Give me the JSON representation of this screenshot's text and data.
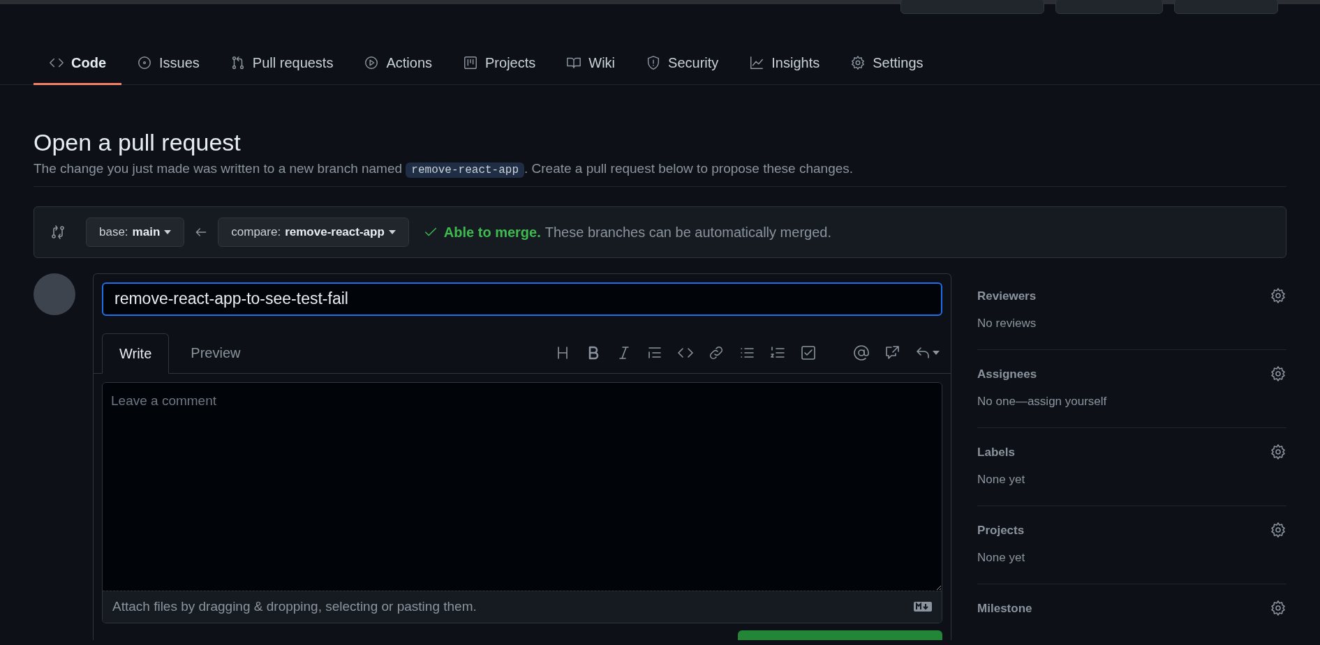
{
  "nav": [
    {
      "label": "Code",
      "selected": true
    },
    {
      "label": "Issues",
      "selected": false
    },
    {
      "label": "Pull requests",
      "selected": false
    },
    {
      "label": "Actions",
      "selected": false
    },
    {
      "label": "Projects",
      "selected": false
    },
    {
      "label": "Wiki",
      "selected": false
    },
    {
      "label": "Security",
      "selected": false
    },
    {
      "label": "Insights",
      "selected": false
    },
    {
      "label": "Settings",
      "selected": false
    }
  ],
  "page": {
    "title": "Open a pull request",
    "intro_before": "The change you just made was written to a new branch named",
    "branch": "remove-react-app",
    "intro_after": ". Create a pull request below to propose these changes."
  },
  "compare": {
    "base_label": "base:",
    "base": "main",
    "compare_label": "compare:",
    "compare": "remove-react-app",
    "merge_status": "Able to merge.",
    "merge_note": "These branches can be automatically merged."
  },
  "form": {
    "title_value": "remove-react-app-to-see-test-fail",
    "tabs": [
      {
        "label": "Write",
        "selected": true
      },
      {
        "label": "Preview",
        "selected": false
      }
    ],
    "comment_placeholder": "Leave a comment",
    "attach_hint": "Attach files by dragging & dropping, selecting or pasting them."
  },
  "sidebar": [
    {
      "title": "Reviewers",
      "value": "No reviews"
    },
    {
      "title": "Assignees",
      "value": "No one—assign yourself"
    },
    {
      "title": "Labels",
      "value": "None yet"
    },
    {
      "title": "Projects",
      "value": "None yet"
    },
    {
      "title": "Milestone"
    }
  ]
}
